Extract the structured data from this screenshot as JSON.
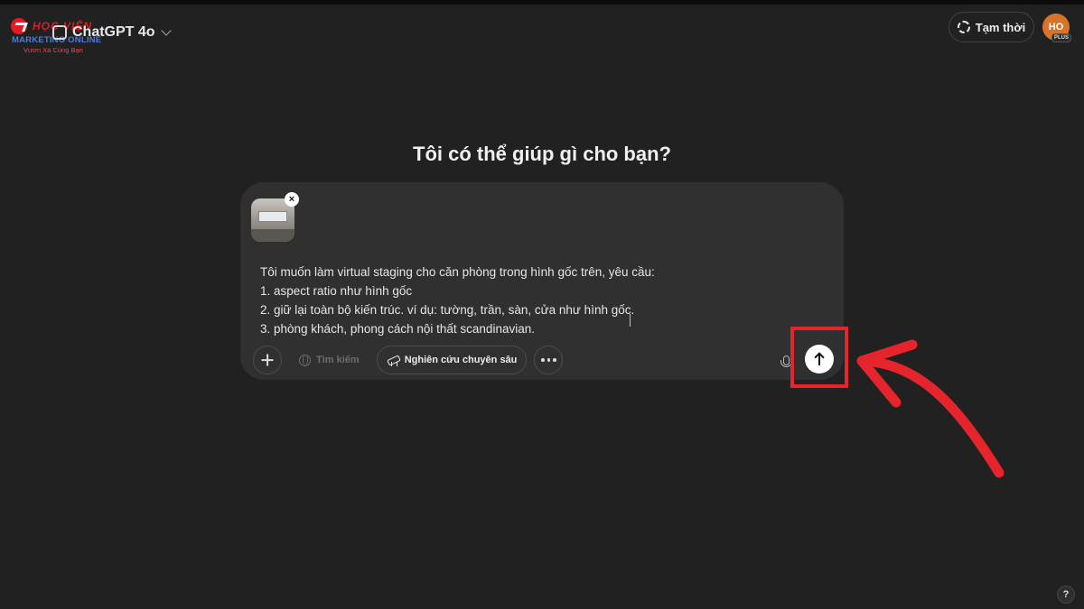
{
  "logo": {
    "brand": "HỌC VIỆN",
    "subtitle": "MARKETING ONLINE",
    "tagline": "Vươn Xa Cùng Bạn"
  },
  "header": {
    "model_name": "ChatGPT 4o",
    "temporary_label": "Tạm thời",
    "avatar_initials": "HO",
    "avatar_badge": "PLUS"
  },
  "main": {
    "greeting": "Tôi có thể giúp gì cho bạn?"
  },
  "composer": {
    "attachment_close": "×",
    "prompt_lines": [
      "Tôi muốn làm virtual staging cho căn phòng trong hình gốc trên, yêu cầu:",
      "1. aspect ratio như hình gốc",
      "2. giữ lại toàn bộ kiến trúc. ví dụ: tường, trần, sàn, cửa như hình gốc.",
      "3. phòng khách, phong cách nội thất scandinavian."
    ],
    "search_label": "Tìm kiếm",
    "deep_research_label": "Nghiên cứu chuyên sâu"
  },
  "help_label": "?",
  "colors": {
    "background": "#212121",
    "composer": "#303030",
    "annotation": "#e5242b",
    "send_button": "#ffffff"
  },
  "icons": [
    "new-chat-icon",
    "chevron-down-icon",
    "temporary-chat-icon",
    "close-icon",
    "plus-icon",
    "globe-icon",
    "telescope-icon",
    "more-icon",
    "microphone-icon",
    "arrow-up-icon"
  ]
}
